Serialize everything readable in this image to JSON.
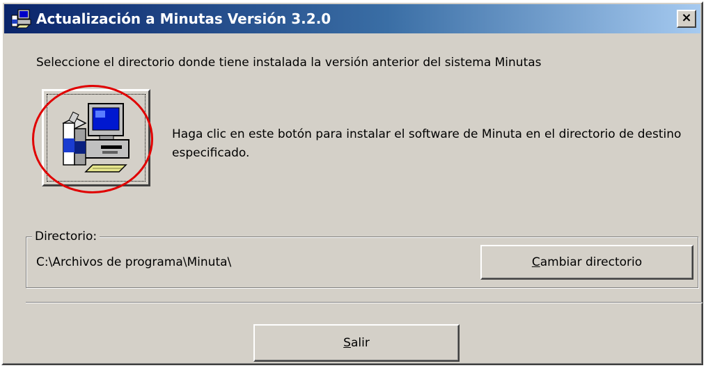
{
  "window": {
    "title": "Actualización a Minutas Versión 3.2.0",
    "close_label": "×"
  },
  "instruction": "Seleccione el directorio donde tiene instalada la versión anterior del sistema Minutas",
  "install": {
    "description": "Haga clic en este botón para instalar el software de Minuta en el directorio de destino especificado.",
    "icon": "computer-install-icon",
    "highlight_color": "#e00000"
  },
  "directory": {
    "legend": "Directorio:",
    "path": "C:\\Archivos de programa\\Minuta\\",
    "change_button": {
      "accel": "C",
      "rest": "ambiar directorio"
    }
  },
  "exit_button": {
    "accel": "S",
    "rest": "alir"
  },
  "colors": {
    "face": "#d4d0c8",
    "title_start": "#0a246a",
    "title_end": "#a6caf0"
  }
}
